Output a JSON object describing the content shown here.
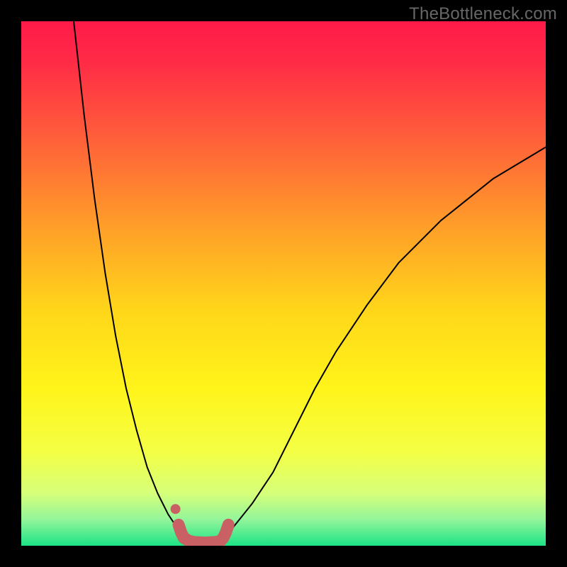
{
  "watermark": "TheBottleneck.com",
  "chart_data": {
    "type": "line",
    "title": "",
    "xlabel": "",
    "ylabel": "",
    "xlim": [
      0,
      100
    ],
    "ylim": [
      0,
      100
    ],
    "grid": false,
    "legend": false,
    "series": [
      {
        "name": "curve-left",
        "x": [
          10,
          12,
          14,
          16,
          18,
          20,
          22,
          24,
          26,
          28,
          30,
          31,
          32
        ],
        "y": [
          100,
          82,
          66,
          52,
          40,
          30,
          22,
          15,
          10,
          6,
          3,
          2,
          1.5
        ]
      },
      {
        "name": "curve-right",
        "x": [
          38,
          40,
          44,
          48,
          52,
          56,
          60,
          66,
          72,
          80,
          90,
          100
        ],
        "y": [
          1.5,
          3,
          8,
          14,
          22,
          30,
          37,
          46,
          54,
          62,
          70,
          76
        ]
      },
      {
        "name": "valley-marker-left-dot",
        "x": [
          30
        ],
        "y": [
          4
        ]
      },
      {
        "name": "valley-marker-u",
        "x": [
          30,
          30.5,
          31,
          32,
          33,
          35,
          37,
          38,
          38.5,
          39,
          39.5
        ],
        "y": [
          4,
          2.5,
          1.5,
          0.9,
          0.7,
          0.6,
          0.7,
          0.9,
          1.5,
          2.5,
          4
        ]
      }
    ],
    "colors": {
      "curve": "#000000",
      "marker": "#C86064",
      "gradient_top": "#FF1A49",
      "gradient_mid": "#FFE300",
      "gradient_bottom": "#21E080"
    }
  }
}
